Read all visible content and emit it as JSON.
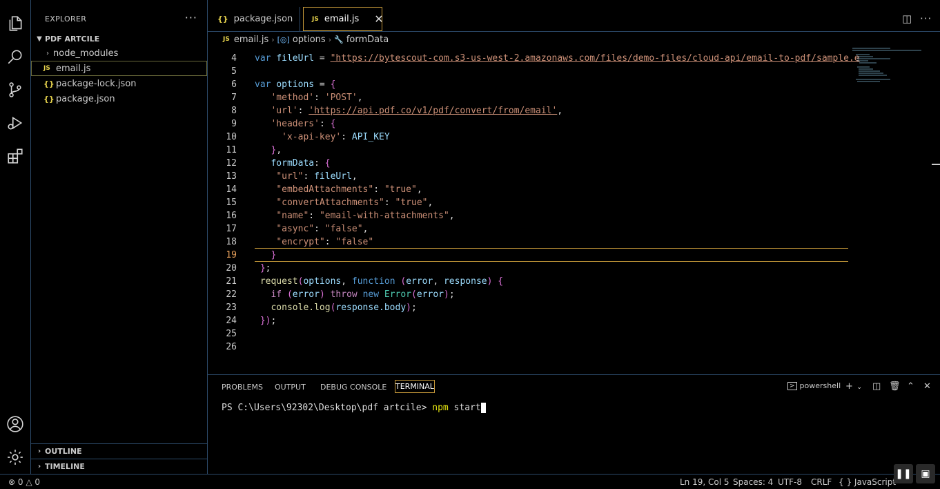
{
  "explorer": {
    "title": "EXPLORER",
    "more": "···",
    "folder": "PDF ARTCILE",
    "items": [
      {
        "label": "node_modules",
        "icon": "chevron-right-icon"
      },
      {
        "label": "email.js",
        "icon": "js-file-icon"
      },
      {
        "label": "package-lock.json",
        "icon": "json-file-icon"
      },
      {
        "label": "package.json",
        "icon": "json-file-icon"
      }
    ],
    "outline": "OUTLINE",
    "timeline": "TIMELINE"
  },
  "tabs": [
    {
      "label": "package.json",
      "icon": "{}"
    },
    {
      "label": "email.js",
      "icon": "JS",
      "close": "✕"
    }
  ],
  "breadcrumb": {
    "file": "email.js",
    "scope1": "options",
    "scope2": "formData",
    "file_icon": "JS"
  },
  "editor": {
    "lines": [
      {
        "n": "4",
        "t": "var fileUrl = \"https://bytescout-com.s3-us-west-2.amazonaws.com/files/demo-files/cloud-api/email-to-pdf/sample.e"
      },
      {
        "n": "5",
        "t": ""
      },
      {
        "n": "6",
        "t": "var options = {"
      },
      {
        "n": "7",
        "t": "   'method': 'POST',"
      },
      {
        "n": "8",
        "t": "   'url': 'https://api.pdf.co/v1/pdf/convert/from/email',"
      },
      {
        "n": "9",
        "t": "   'headers': {"
      },
      {
        "n": "10",
        "t": "     'x-api-key': API_KEY"
      },
      {
        "n": "11",
        "t": "   },"
      },
      {
        "n": "12",
        "t": "   formData: {"
      },
      {
        "n": "13",
        "t": "    \"url\": fileUrl,"
      },
      {
        "n": "14",
        "t": "    \"embedAttachments\": \"true\","
      },
      {
        "n": "15",
        "t": "    \"convertAttachments\": \"true\","
      },
      {
        "n": "16",
        "t": "    \"name\": \"email-with-attachments\","
      },
      {
        "n": "17",
        "t": "    \"async\": \"false\","
      },
      {
        "n": "18",
        "t": "    \"encrypt\": \"false\""
      },
      {
        "n": "19",
        "t": "   }"
      },
      {
        "n": "20",
        "t": " };"
      },
      {
        "n": "21",
        "t": " request(options, function (error, response) {"
      },
      {
        "n": "22",
        "t": "   if (error) throw new Error(error);"
      },
      {
        "n": "23",
        "t": "   console.log(response.body);"
      },
      {
        "n": "24",
        "t": " });"
      },
      {
        "n": "25",
        "t": ""
      },
      {
        "n": "26",
        "t": ""
      }
    ]
  },
  "panel": {
    "tabs": [
      "PROBLEMS",
      "OUTPUT",
      "DEBUG CONSOLE",
      "TERMINAL"
    ],
    "shell": "powershell",
    "prompt": "PS C:\\Users\\92302\\Desktop\\pdf artcile> ",
    "command": "npm",
    "args": " start"
  },
  "status": {
    "errors": "0",
    "warnings": "0",
    "position": "Ln 19, Col 5",
    "spaces": "Spaces: 4",
    "encoding": "UTF-8",
    "eol": "CRLF",
    "language": "JavaScript",
    "language_icon": "{ }"
  }
}
